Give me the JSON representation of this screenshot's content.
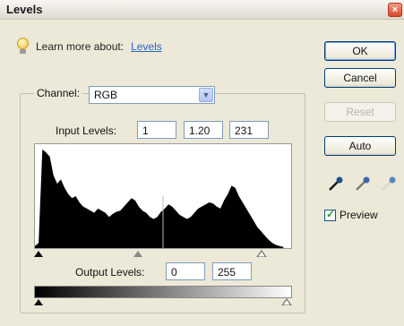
{
  "window": {
    "title": "Levels",
    "close_glyph": "×"
  },
  "learn": {
    "label": "Learn more about:",
    "link": "Levels"
  },
  "channel": {
    "label": "Channel:",
    "value": "RGB",
    "dropdown_glyph": "▼"
  },
  "input_levels": {
    "label": "Input Levels:",
    "black": "1",
    "gamma": "1.20",
    "white": "231"
  },
  "output_levels": {
    "label": "Output Levels:",
    "black": "0",
    "white": "255"
  },
  "buttons": {
    "ok": "OK",
    "cancel": "Cancel",
    "reset": "Reset",
    "auto": "Auto"
  },
  "preview": {
    "label": "Preview",
    "checked": true
  },
  "icons": {
    "bulb": "lightbulb-icon",
    "eyedroppers": [
      "black-point-eyedropper-icon",
      "gray-point-eyedropper-icon",
      "white-point-eyedropper-icon"
    ]
  },
  "histogram": {
    "levels": [
      2,
      5,
      95,
      92,
      88,
      70,
      62,
      66,
      58,
      52,
      48,
      50,
      44,
      40,
      38,
      36,
      34,
      38,
      36,
      34,
      30,
      33,
      35,
      36,
      40,
      44,
      48,
      46,
      40,
      36,
      34,
      30,
      28,
      30,
      35,
      38,
      42,
      40,
      36,
      32,
      30,
      28,
      30,
      34,
      38,
      40,
      42,
      44,
      43,
      40,
      38,
      46,
      52,
      60,
      58,
      50,
      44,
      38,
      32,
      26,
      20,
      16,
      12,
      8,
      5,
      3,
      2,
      1
    ]
  },
  "sliders": {
    "input_black": 0,
    "input_gamma": 0.4,
    "input_white": 0.9,
    "output_black": 0,
    "output_white": 1
  }
}
